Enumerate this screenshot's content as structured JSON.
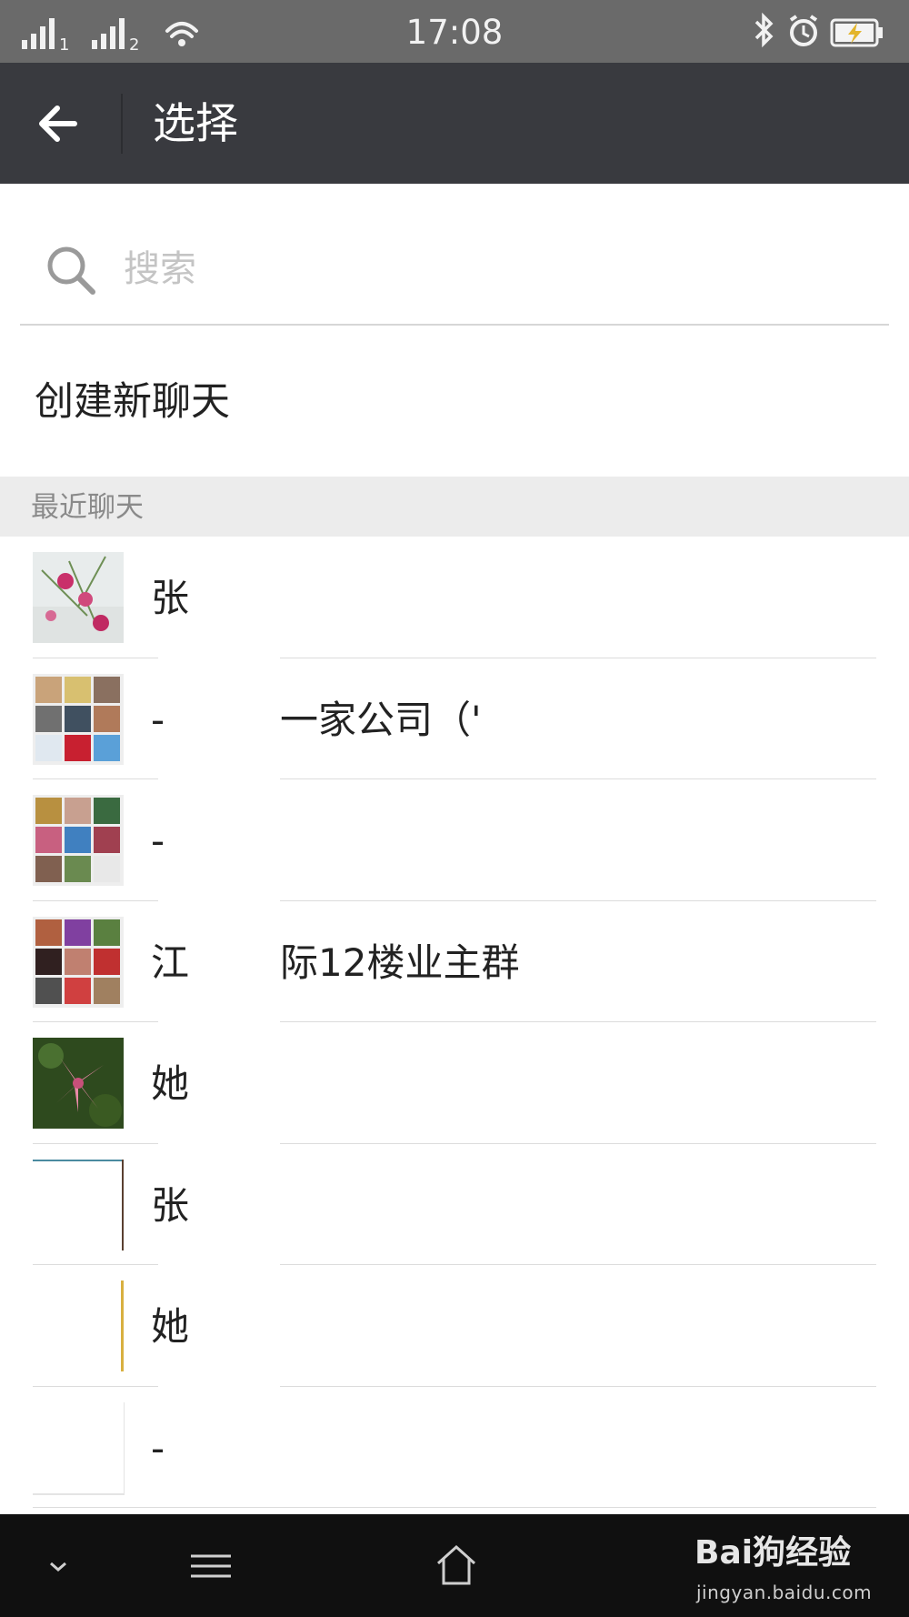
{
  "status_bar": {
    "time": "17:08",
    "sim1": "1",
    "sim2": "2"
  },
  "header": {
    "title": "选择"
  },
  "search": {
    "placeholder": "搜索"
  },
  "create_new_chat": "创建新聊天",
  "section_title": "最近聊天",
  "chats": [
    {
      "name": "张",
      "avatar": "flowers-pink"
    },
    {
      "name": "-",
      "name2": "一家公司（'",
      "avatar": "group-grid"
    },
    {
      "name": "-",
      "avatar": "group-grid-2"
    },
    {
      "name": "江",
      "name2": "际12楼业主群",
      "avatar": "group-grid-3"
    },
    {
      "name": "她",
      "avatar": "lily-flower"
    },
    {
      "name": "张",
      "avatar": "partial-photo"
    },
    {
      "name": "她",
      "avatar": "partial-yellow"
    },
    {
      "name": "-",
      "avatar": "partial-white"
    }
  ],
  "watermark": {
    "logo_text": "Bai狗经验",
    "url": "jingyan.baidu.com"
  },
  "colors": {
    "status_bar": "#6a6a6a",
    "header": "#393a3f",
    "section": "#ececec",
    "nav_bar": "#101010"
  }
}
